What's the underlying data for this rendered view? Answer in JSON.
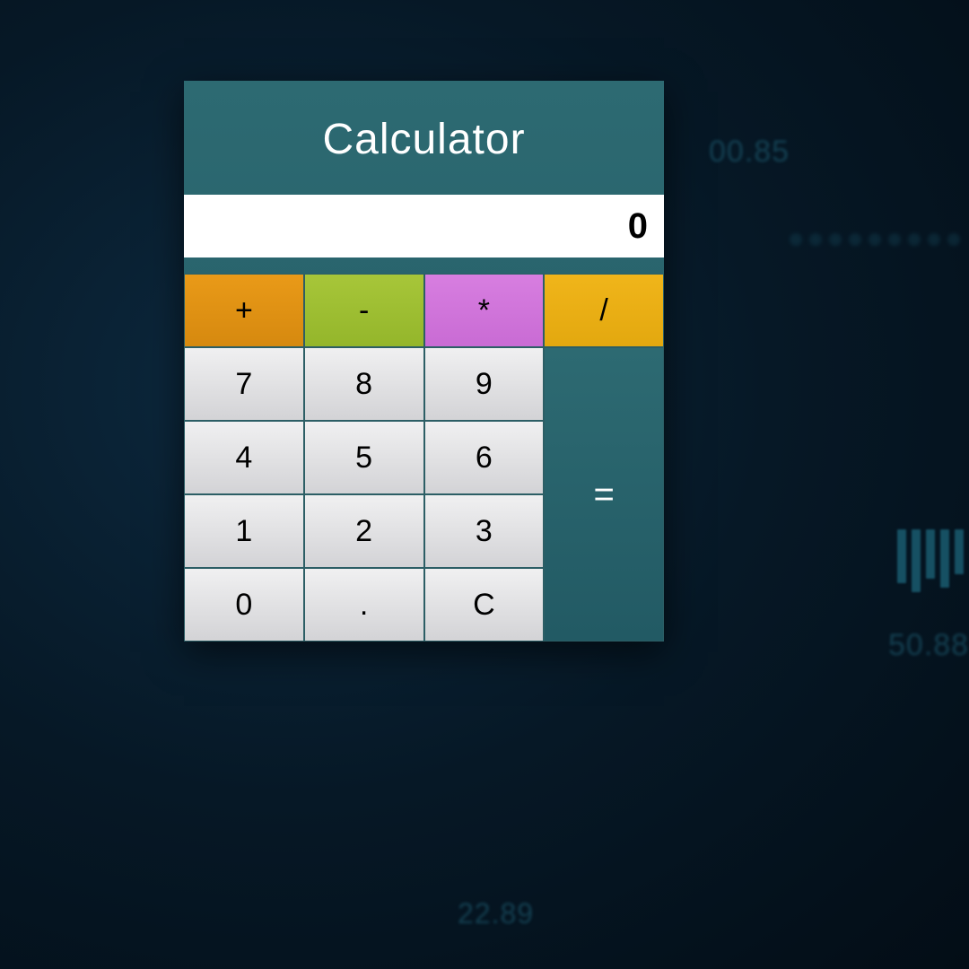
{
  "title": "Calculator",
  "display_value": "0",
  "operators": {
    "plus": "+",
    "minus": "-",
    "mult": "*",
    "div": "/"
  },
  "keys": {
    "k7": "7",
    "k8": "8",
    "k9": "9",
    "k4": "4",
    "k5": "5",
    "k6": "6",
    "k1": "1",
    "k2": "2",
    "k3": "3",
    "k0": "0",
    "dot": ".",
    "clear": "C",
    "equals": "="
  },
  "background_labels": {
    "n1": "00.85",
    "n2": "50.88",
    "n3": "22.89"
  },
  "colors": {
    "panel": "#2a636c",
    "op_plus": "#e0921a",
    "op_minus": "#9fbf33",
    "op_mult": "#d176da",
    "op_div": "#eab015",
    "key_bg": "#e4e4e6"
  }
}
